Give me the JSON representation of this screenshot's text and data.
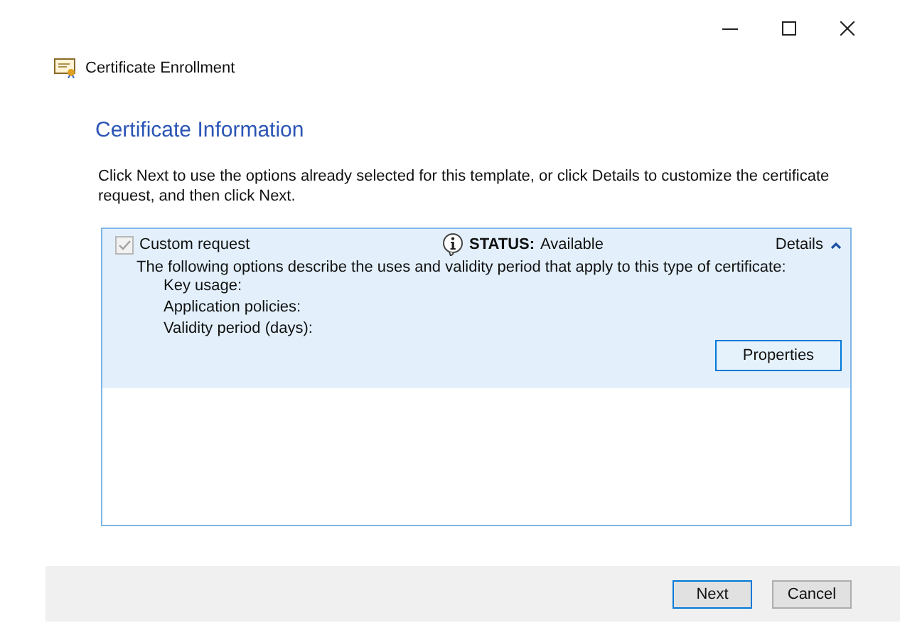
{
  "window": {
    "title": "Certificate Enrollment"
  },
  "heading": "Certificate Information",
  "instructions": "Click Next to use the options already selected for this template, or click Details to customize the certificate request, and then click Next.",
  "requests": [
    {
      "label": "Custom request",
      "checked": true,
      "disabled": true,
      "status_label": "STATUS:",
      "status": "Available",
      "details_label": "Details",
      "expanded": true,
      "description": "The following options describe the uses and validity period that apply to this type of certificate:",
      "fields": [
        "Key usage:",
        "Application policies:",
        "Validity period (days):"
      ],
      "button": "Properties"
    }
  ],
  "buttons": [
    {
      "label": "Next",
      "selected": true
    },
    {
      "label": "Cancel",
      "selected": false
    }
  ]
}
